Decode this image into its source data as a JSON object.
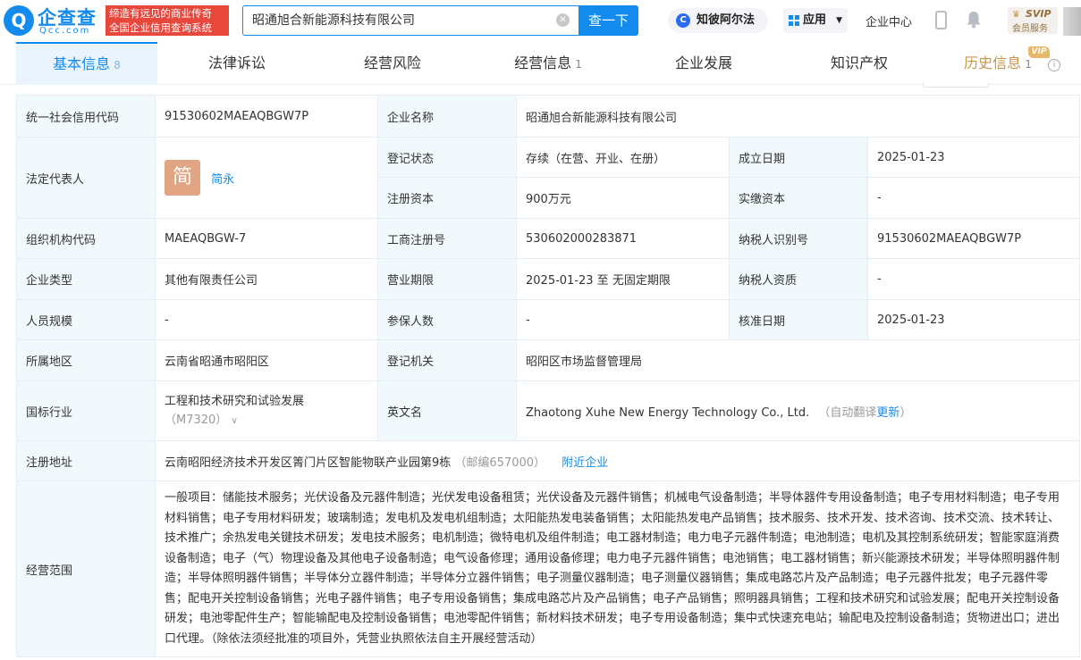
{
  "header": {
    "logo_mark": "Q",
    "logo_name": "企查查",
    "logo_domain": "Qcc.com",
    "slogan_line1": "缔造有远见的商业传奇",
    "slogan_line2": "全国企业信用查询系统",
    "search_value": "昭通旭合新能源科技有限公司",
    "search_button": "查一下",
    "zhibi_label": "知彼阿尔法",
    "app_label": "应用",
    "enterprise_center": "企业中心",
    "svip_label": "SVIP",
    "member_label": "会员服务"
  },
  "tabs": [
    {
      "label": "基本信息",
      "count": "8"
    },
    {
      "label": "法律诉讼",
      "count": ""
    },
    {
      "label": "经营风险",
      "count": ""
    },
    {
      "label": "经营信息",
      "count": "1"
    },
    {
      "label": "企业发展",
      "count": ""
    },
    {
      "label": "知识产权",
      "count": ""
    },
    {
      "label": "历史信息",
      "count": "1"
    }
  ],
  "vip_tag": "VIP",
  "info": {
    "credit_code_label": "统一社会信用代码",
    "credit_code": "91530602MAEAQBGW7P",
    "company_name_label": "企业名称",
    "company_name": "昭通旭合新能源科技有限公司",
    "legal_rep_label": "法定代表人",
    "legal_rep_avatar": "简",
    "legal_rep": "简永",
    "reg_status_label": "登记状态",
    "reg_status": "存续（在营、开业、在册）",
    "est_date_label": "成立日期",
    "est_date": "2025-01-23",
    "reg_capital_label": "注册资本",
    "reg_capital": "900万元",
    "paid_capital_label": "实缴资本",
    "paid_capital": "-",
    "org_code_label": "组织机构代码",
    "org_code": "MAEAQBGW-7",
    "biz_reg_no_label": "工商注册号",
    "biz_reg_no": "530602000283871",
    "taxpayer_id_label": "纳税人识别号",
    "taxpayer_id": "91530602MAEAQBGW7P",
    "ent_type_label": "企业类型",
    "ent_type": "其他有限责任公司",
    "term_label": "营业期限",
    "term": "2025-01-23 至 无固定期限",
    "taxpayer_qual_label": "纳税人资质",
    "taxpayer_qual": "-",
    "staff_size_label": "人员规模",
    "staff_size": "-",
    "insured_label": "参保人数",
    "insured": "-",
    "approval_date_label": "核准日期",
    "approval_date": "2025-01-23",
    "region_label": "所属地区",
    "region": "云南省昭通市昭阳区",
    "authority_label": "登记机关",
    "authority": "昭阳区市场监督管理局",
    "industry_label": "国标行业",
    "industry": "工程和技术研究和试验发展",
    "industry_code": "（M7320）",
    "english_name_label": "英文名",
    "english_name": "Zhaotong Xuhe New Energy Technology Co., Ltd.",
    "auto_translate": "（自动翻译",
    "update_link": "更新",
    "auto_translate_end": "）",
    "address_label": "注册地址",
    "address": "云南昭阳经济技术开发区箐门片区智能物联产业园第9栋",
    "postcode": "（邮编657000）",
    "nearby_link": "附近企业",
    "scope_label": "经营范围",
    "scope": "一般项目：储能技术服务；光伏设备及元器件制造；光伏发电设备租赁；光伏设备及元器件销售；机械电气设备制造；半导体器件专用设备制造；电子专用材料制造；电子专用材料销售；电子专用材料研发；玻璃制造；发电机及发电机组制造；太阳能热发电装备销售；太阳能热发电产品销售；技术服务、技术开发、技术咨询、技术交流、技术转让、技术推广；余热发电关键技术研发；发电技术服务；电机制造；微特电机及组件制造；电工器材制造；电力电子元器件制造；电池制造；电机及其控制系统研发；智能家庭消费设备制造；电子（气）物理设备及其他电子设备制造；电气设备修理；通用设备修理；电力电子元器件销售；电池销售；电工器材销售；新兴能源技术研发；半导体照明器件制造；半导体照明器件销售；半导体分立器件制造；半导体分立器件销售；电子测量仪器制造；电子测量仪器销售；集成电路芯片及产品制造；电子元器件批发；电子元器件零售；配电开关控制设备销售；光电子器件销售；电子专用设备销售；集成电路芯片及产品销售；电子产品销售；照明器具销售；工程和技术研究和试验发展；配电开关控制设备研发；电池零配件生产；智能输配电及控制设备销售；电池零配件销售；新材料技术研发；电子专用设备制造；集中式快速充电站；输配电及控制设备制造；货物进出口；进出口代理。（除依法须经批准的项目外，凭营业执照依法自主开展经营活动）"
  }
}
